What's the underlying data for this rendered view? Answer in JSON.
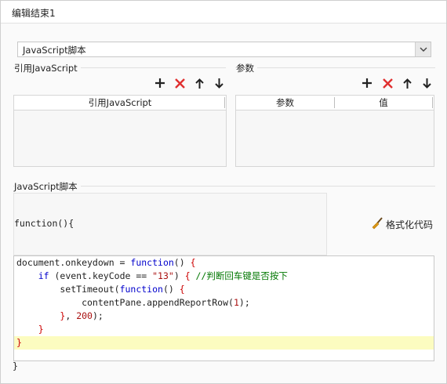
{
  "window": {
    "title": "编辑结束1"
  },
  "script_type": {
    "value": "JavaScript脚本"
  },
  "ref_js_group": {
    "label": "引用JavaScript",
    "header": "引用JavaScript"
  },
  "params_group": {
    "label": "参数",
    "headers": [
      "参数",
      "值"
    ]
  },
  "script_group": {
    "label": "JavaScript脚本"
  },
  "function_header": "function(){",
  "format_button": {
    "label": "格式化代码"
  },
  "editor": {
    "lines": [
      [
        {
          "t": "document.onkeydown = ",
          "c": ""
        },
        {
          "t": "function",
          "c": "kw"
        },
        {
          "t": "() ",
          "c": ""
        },
        {
          "t": "{",
          "c": "red"
        }
      ],
      [
        {
          "t": "    ",
          "c": ""
        },
        {
          "t": "if",
          "c": "kw"
        },
        {
          "t": " (event.keyCode == ",
          "c": ""
        },
        {
          "t": "\"13\"",
          "c": "str"
        },
        {
          "t": ") ",
          "c": ""
        },
        {
          "t": "{",
          "c": "red"
        },
        {
          "t": " //判断回车键是否按下",
          "c": "cmt"
        }
      ],
      [
        {
          "t": "        setTimeout(",
          "c": ""
        },
        {
          "t": "function",
          "c": "kw"
        },
        {
          "t": "() ",
          "c": ""
        },
        {
          "t": "{",
          "c": "red"
        }
      ],
      [
        {
          "t": "            contentPane.appendReportRow(",
          "c": ""
        },
        {
          "t": "1",
          "c": "num"
        },
        {
          "t": ");",
          "c": ""
        }
      ],
      [
        {
          "t": "        ",
          "c": ""
        },
        {
          "t": "}",
          "c": "red"
        },
        {
          "t": ", ",
          "c": ""
        },
        {
          "t": "200",
          "c": "num"
        },
        {
          "t": ");",
          "c": ""
        }
      ],
      [
        {
          "t": "    ",
          "c": ""
        },
        {
          "t": "}",
          "c": "red"
        }
      ],
      [
        {
          "t": "}",
          "c": "red"
        }
      ]
    ],
    "highlighted_line": 6
  },
  "function_footer": "}",
  "icons": {
    "add": "plus-icon",
    "delete": "delete-x-icon",
    "up": "arrow-up-icon",
    "down": "arrow-down-icon",
    "format": "broom-icon",
    "dropdown": "chevron-down-icon"
  },
  "colors": {
    "delete": "#e03030",
    "keyword": "#0000cc",
    "string": "#aa1111",
    "comment": "#007700",
    "highlight": "#fcfcc0"
  }
}
